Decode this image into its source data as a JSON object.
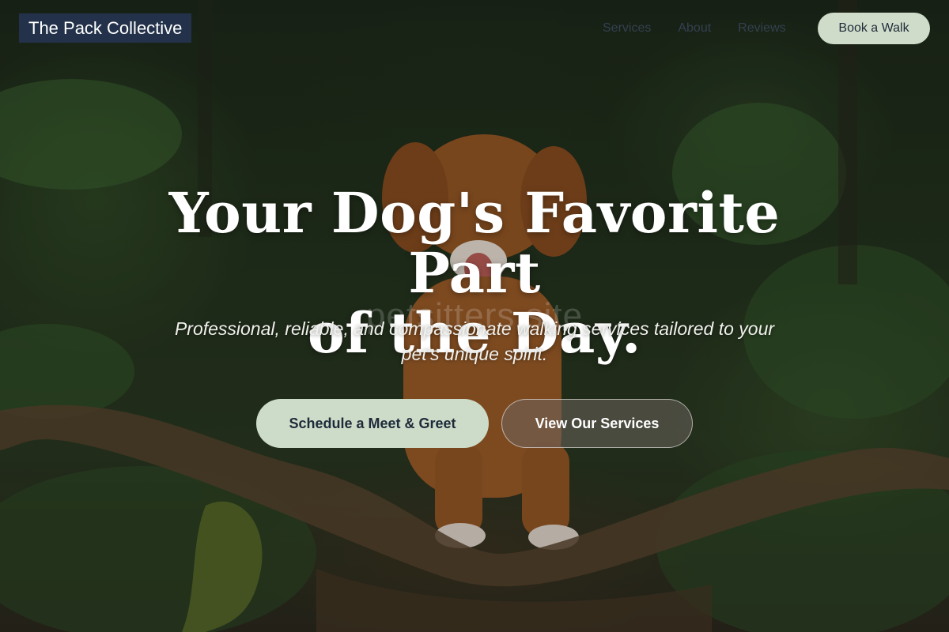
{
  "nav": {
    "logo": "The Pack Collective",
    "links": [
      "Services",
      "About",
      "Reviews"
    ],
    "cta": "Book a Walk"
  },
  "hero": {
    "headline_line1": "Your Dog's Favorite Part",
    "headline_line2": "of the Day.",
    "watermark": "petsitters.site",
    "subtitle_line1": "Professional, reliable, and compassionate walking services tailored to your",
    "subtitle_line2": "pet's unique spirit.",
    "primary_cta": "Schedule a Meet & Greet",
    "secondary_cta": "View Our Services"
  },
  "colors": {
    "accent": "#cfdcc9",
    "logo_bg": "#23324a",
    "text_dark": "#1f2a3a"
  },
  "background": {
    "description_icon": "forest-dog-photo"
  }
}
